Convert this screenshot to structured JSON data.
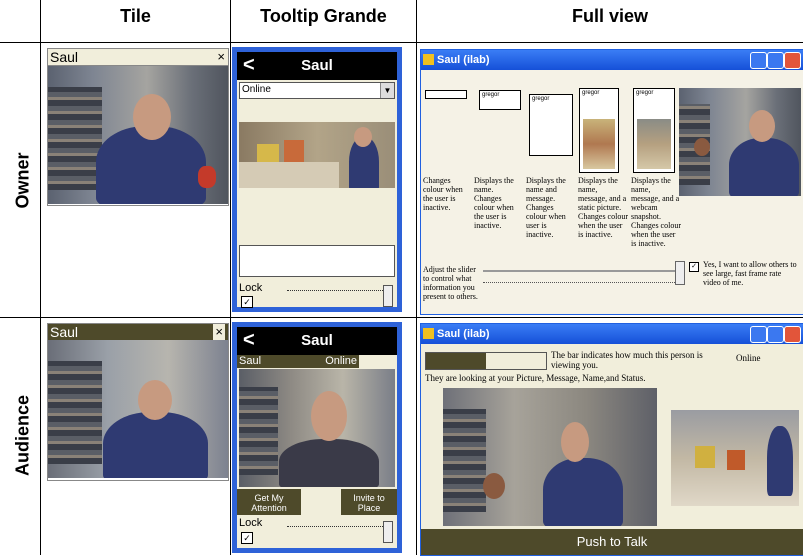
{
  "headers": {
    "tile": "Tile",
    "tooltip": "Tooltip Grande",
    "full": "Full view"
  },
  "rows": {
    "owner": "Owner",
    "audience": "Audience"
  },
  "owner": {
    "tile": {
      "name": "Saul",
      "close": "×"
    },
    "tooltip": {
      "back": "<",
      "title": "Saul",
      "status_value": "Online",
      "lock_label": "Lock"
    },
    "full": {
      "window_title": "Saul (ilab)",
      "panel_labels": [
        "gregor",
        "gregor",
        "gregor",
        "gregor"
      ],
      "captions": [
        "Changes colour when the user is inactive.",
        "Displays the name. Changes colour when the user is inactive.",
        "Displays the name and message. Changes colour when user is inactive.",
        "Displays the name, message, and a static picture. Changes colour when the user is inactive.",
        "Displays the name, message, and a webcam snapshot. Changes colour when the user is inactive."
      ],
      "slider_caption": "Adjust the slider to control what information you present to others.",
      "checkbox_label": "Yes, I want to allow others to see large, fast frame rate video of me."
    }
  },
  "audience": {
    "tile": {
      "name": "Saul",
      "close": "×"
    },
    "tooltip": {
      "back": "<",
      "title": "Saul",
      "name": "Saul",
      "status": "Online",
      "btn_attention": "Get My Attention",
      "btn_invite": "Invite to Place",
      "lock_label": "Lock"
    },
    "full": {
      "window_title": "Saul (ilab)",
      "bar_caption": "The bar indicates how much this person is viewing you.",
      "status": "Online",
      "looking_caption": "They are looking at your Picture, Message, Name,and Status.",
      "push_to_talk": "Push to Talk"
    }
  },
  "colors": {
    "olive": "#4e4a2a",
    "tooltip_frame": "#2e62d8",
    "title_blue": "#1550d8"
  }
}
